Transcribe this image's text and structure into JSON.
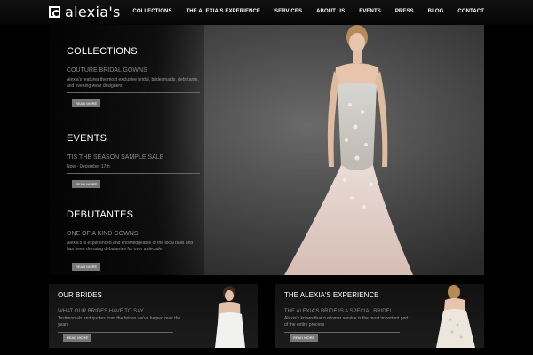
{
  "header": {
    "logo_text": "alexia's",
    "nav": [
      "COLLECTIONS",
      "THE ALEXIA'S EXPERIENCE",
      "SERVICES",
      "ABOUT US",
      "EVENTS",
      "PRESS",
      "BLOG",
      "CONTACT"
    ]
  },
  "sections": [
    {
      "title": "COLLECTIONS",
      "subtitle": "COUTURE BRIDAL GOWNS",
      "desc": "Alexia's features the most exclusive bridal, bridesmaids, debutante, and evening wear designers",
      "button": "READ MORE"
    },
    {
      "title": "EVENTS",
      "subtitle": "'TIS THE SEASON SAMPLE SALE",
      "desc": "Now - December 17th",
      "button": "READ MORE"
    },
    {
      "title": "DEBUTANTES",
      "subtitle": "ONE OF A KIND GOWNS",
      "desc": "Alexia's is experienced and knowledgeable of the local balls and has been dressing debutantes for over a decade",
      "button": "READ MORE"
    }
  ],
  "boxes": [
    {
      "title": "OUR BRIDES",
      "subtitle": "WHAT OUR BRIDES HAVE TO SAY...",
      "desc": "Testimonials and quotes from the brides we've helped over the years",
      "button": "READ MORE"
    },
    {
      "title": "THE ALEXIA'S EXPERIENCE",
      "subtitle": "THE ALEXIA'S BRIDE IS A SPECIAL BRIDE!",
      "desc": "Alexia's knows that customer service is the most important part of the entire process",
      "button": "READ MORE"
    }
  ]
}
